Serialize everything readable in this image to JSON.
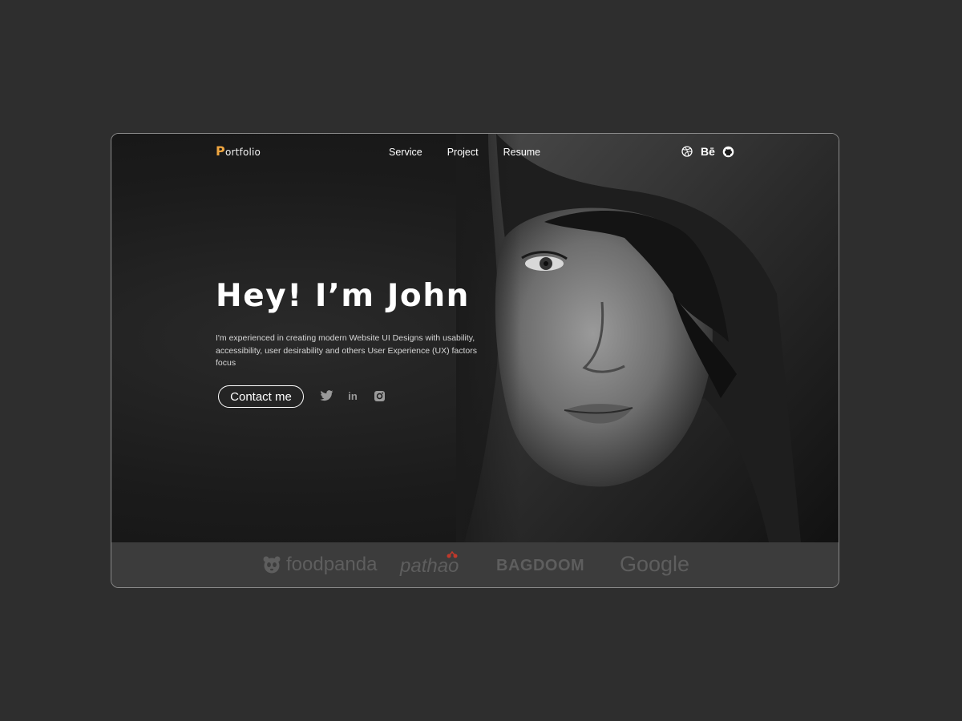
{
  "nav": {
    "logo_initial": "P",
    "logo_rest": "ortfolio",
    "links": [
      {
        "label": "Service"
      },
      {
        "label": "Project"
      },
      {
        "label": "Resume"
      }
    ],
    "icons": [
      "dribbble-icon",
      "behance-icon",
      "github-icon"
    ],
    "behance_label": "Bē"
  },
  "hero": {
    "headline": "Hey! I’m John",
    "intro": "I'm experienced in creating modern Website UI Designs with usability, accessibility, user desirability and others User Experience (UX) factors focus",
    "cta_label": "Contact me",
    "social_icons": [
      "twitter-icon",
      "linkedin-icon",
      "instagram-icon"
    ],
    "linkedin_label": "in"
  },
  "brands": [
    {
      "name": "foodpanda"
    },
    {
      "name": "pathao"
    },
    {
      "name": "BAGDOOM"
    },
    {
      "name": "Google"
    }
  ],
  "colors": {
    "page_bg": "#2e2e2e",
    "hero_bg": "#1b1b1b",
    "accent": "#f0a640",
    "brand_bar": "#3c3c3c",
    "brand_text": "#5e5e5e"
  }
}
